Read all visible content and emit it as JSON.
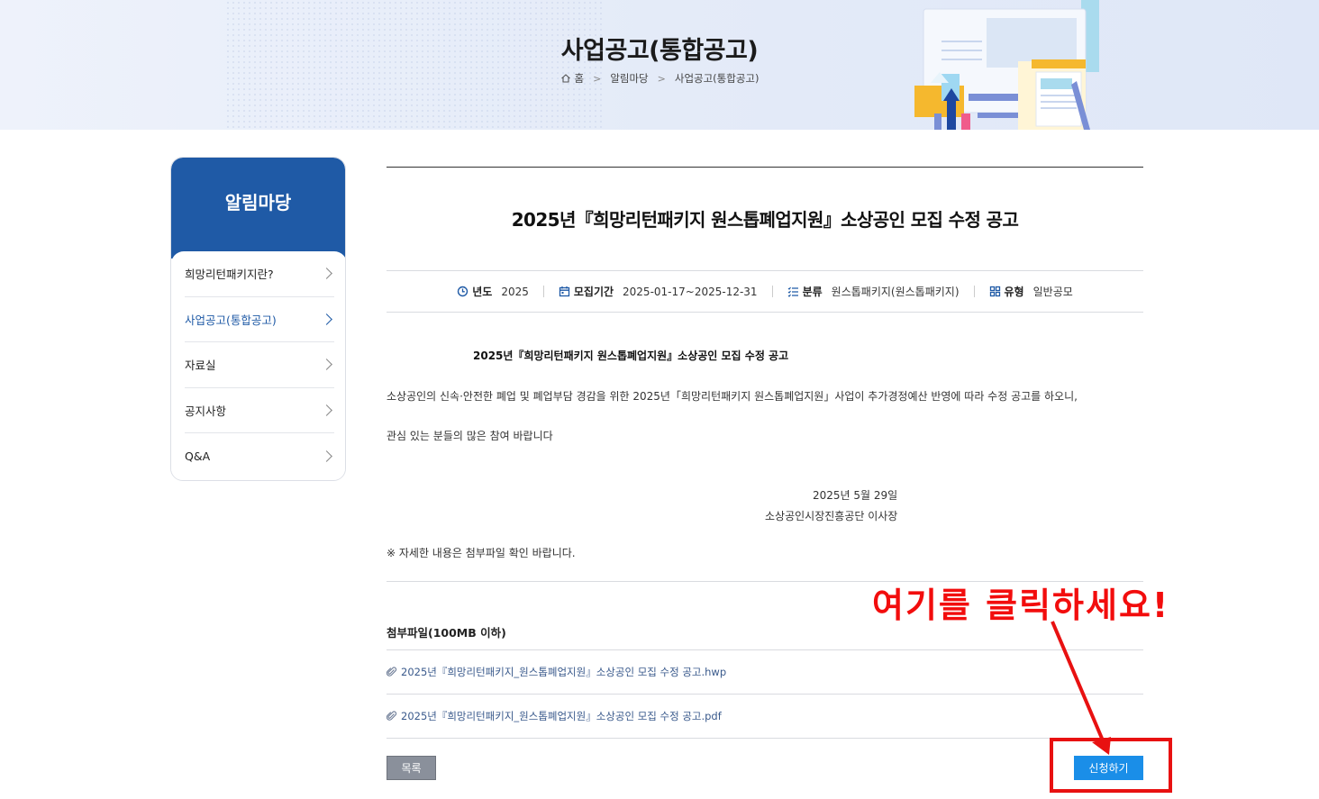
{
  "banner": {
    "title": "사업공고(통합공고)",
    "breadcrumb": [
      "홈",
      "알림마당",
      "사업공고(통합공고)"
    ]
  },
  "sidebar": {
    "title": "알림마당",
    "items": [
      {
        "label": "희망리턴패키지란?"
      },
      {
        "label": "사업공고(통합공고)"
      },
      {
        "label": "자료실"
      },
      {
        "label": "공지사항"
      },
      {
        "label": "Q&A"
      }
    ]
  },
  "post": {
    "title": "2025년『희망리턴패키지 원스톱폐업지원』소상공인 모집 수정 공고",
    "meta": {
      "year_label": "년도",
      "year": "2025",
      "period_label": "모집기간",
      "period": "2025-01-17~2025-12-31",
      "category_label": "분류",
      "category": "원스톱패키지(원스톱패키지)",
      "type_label": "유형",
      "type": "일반공모"
    },
    "body": {
      "heading": "2025년『희망리턴패키지 원스톱폐업지원』소상공인 모집 수정 공고",
      "p1": "소상공인의 신속·안전한 폐업 및 폐업부담 경감을 위한 2025년「희망리턴패키지 원스톱폐업지원」사업이 추가경정예산 반영에 따라 수정 공고를 하오니,",
      "p2": "관심 있는 분들의 많은 참여 바랍니다",
      "date": "2025년 5월 29일",
      "signer": "소상공인시장진흥공단 이사장",
      "note": "※ 자세한 내용은 첨부파일 확인 바랍니다."
    },
    "attachments_title": "첨부파일(100MB 이하)",
    "attachments": [
      {
        "name": "2025년『희망리턴패키지_원스톱폐업지원』소상공인 모집 수정 공고.hwp"
      },
      {
        "name": "2025년『희망리턴패키지_원스톱폐업지원』소상공인 모집 수정 공고.pdf"
      }
    ],
    "list_button": "목록",
    "apply_button": "신청하기"
  },
  "annotation": {
    "text": "여기를 클릭하세요!",
    "color": "#f20d0d"
  }
}
